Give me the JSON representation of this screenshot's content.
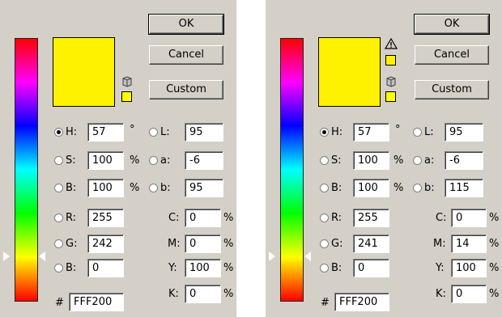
{
  "buttons": {
    "ok": "OK",
    "cancel": "Cancel",
    "custom": "Custom"
  },
  "labels": {
    "h": "H:",
    "s": "S:",
    "b": "B:",
    "l": "L:",
    "a": "a:",
    "lab_b": "b:",
    "r": "R:",
    "g": "G:",
    "rgb_b": "B:",
    "c": "C:",
    "m": "M:",
    "y": "Y:",
    "k": "K:",
    "hash": "#"
  },
  "units": {
    "degree": "°",
    "percent": "%"
  },
  "colors": {
    "current": "#FFF200",
    "websafe": "#FFFF00",
    "gamut": "#FFF200"
  },
  "icons": {
    "gamut_warning": "warning-triangle-icon",
    "websafe": "cube-icon"
  },
  "left": {
    "h": "57",
    "s": "100",
    "b": "100",
    "l": "95",
    "a": "-6",
    "lab_b": "95",
    "r": "255",
    "g": "242",
    "rgb_b": "0",
    "c": "0",
    "m": "0",
    "y": "100",
    "k": "0",
    "hex": "FFF200",
    "hue_level": 0.843
  },
  "right": {
    "h": "57",
    "s": "100",
    "b": "100",
    "l": "95",
    "a": "-6",
    "lab_b": "115",
    "r": "255",
    "g": "241",
    "rgb_b": "0",
    "c": "0",
    "m": "14",
    "y": "100",
    "k": "0",
    "hex": "FFF200",
    "hue_level": 0.843
  }
}
